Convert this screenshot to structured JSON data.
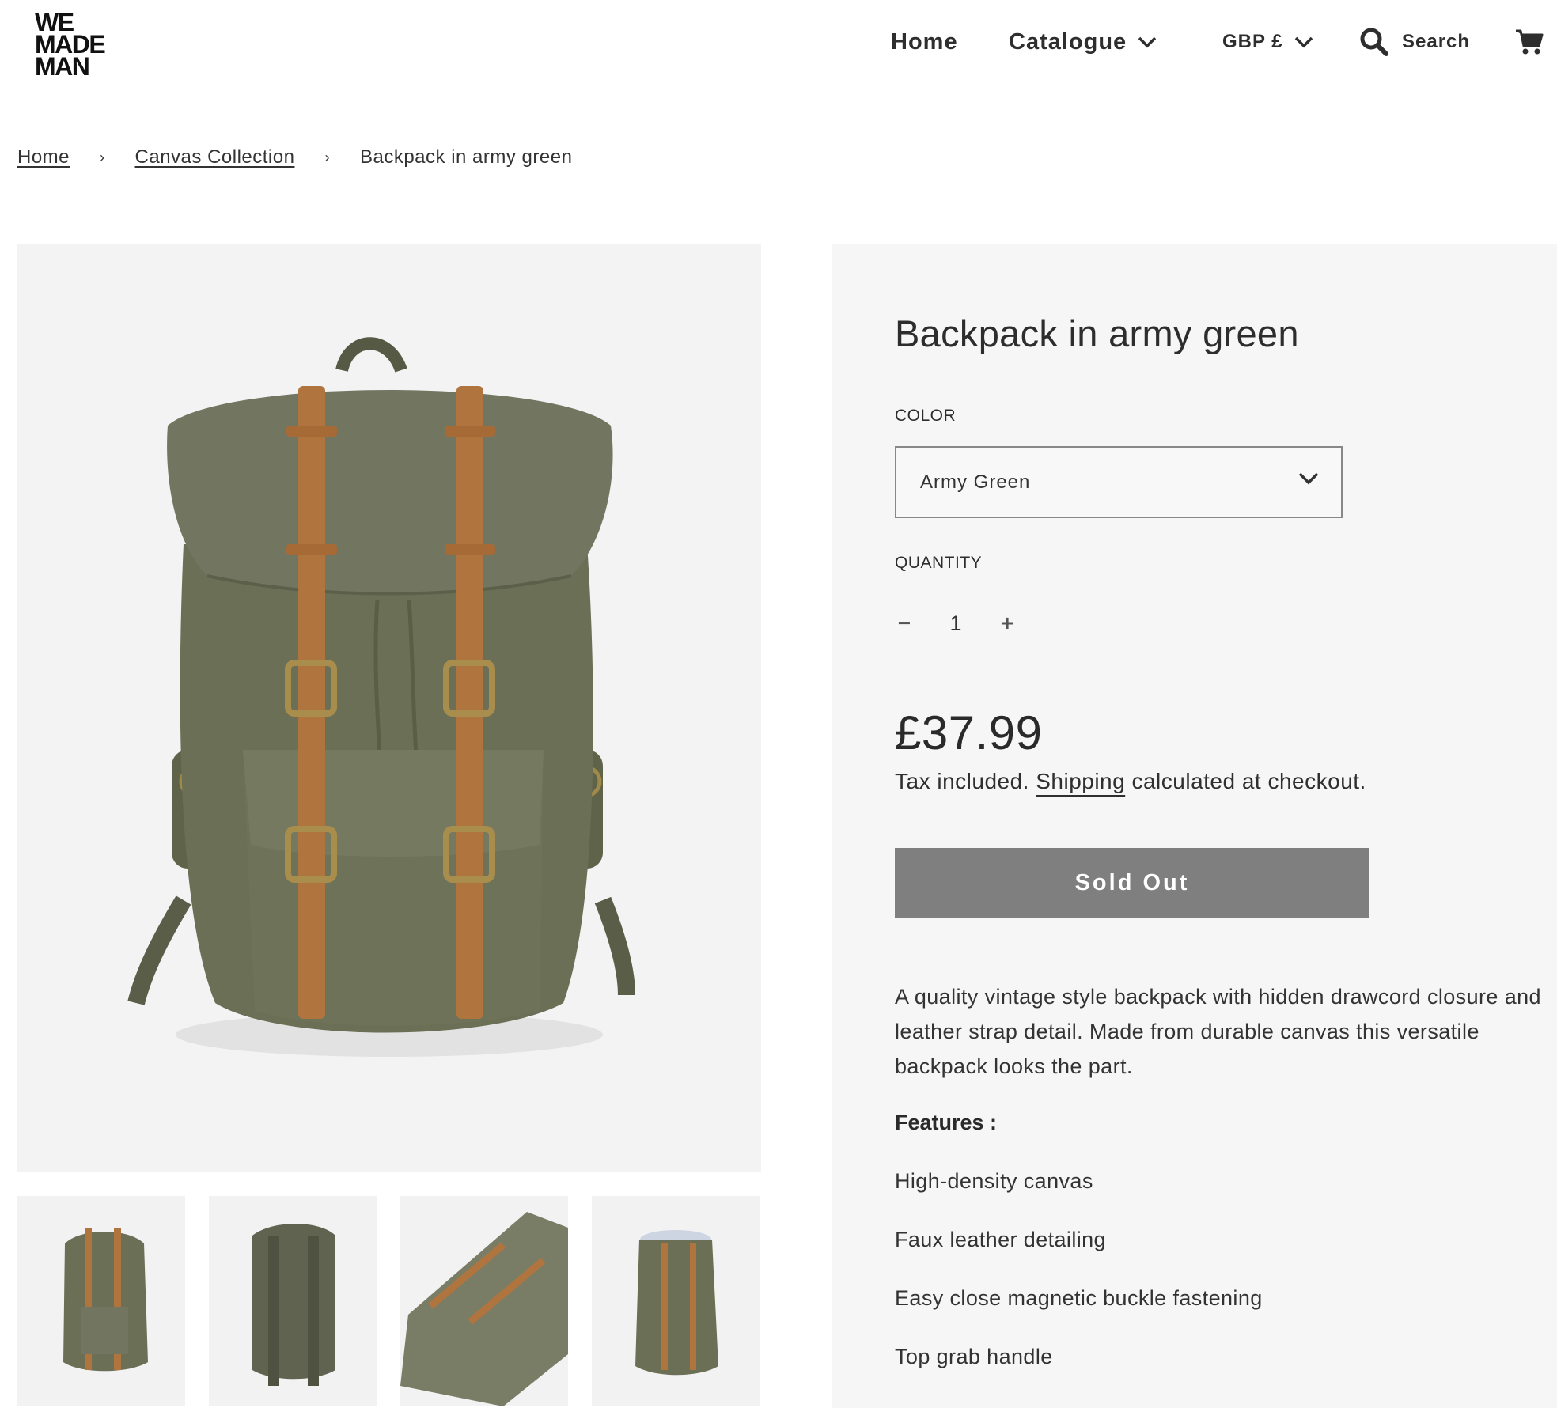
{
  "brand": {
    "logo_lines": [
      "WE",
      "MADE",
      "MAN"
    ]
  },
  "nav": {
    "home": "Home",
    "catalogue": "Catalogue",
    "currency": "GBP £",
    "search": "Search",
    "icons": [
      "chevron-down-icon",
      "search-icon",
      "cart-icon"
    ]
  },
  "breadcrumb": {
    "items": [
      "Home",
      "Canvas Collection",
      "Backpack in army green"
    ],
    "separator": "›"
  },
  "product": {
    "title": "Backpack in army green",
    "color_label": "COLOR",
    "color_value": "Army Green",
    "quantity_label": "QUANTITY",
    "quantity_value": "1",
    "minus": "−",
    "plus": "+",
    "price": "£37.99",
    "tax_prefix": "Tax included.",
    "tax_link": "Shipping",
    "tax_suffix": "calculated at checkout.",
    "button": "Sold Out",
    "description": "A quality vintage style backpack with hidden drawcord closure and leather strap detail. Made from durable canvas this versatile backpack looks the part.",
    "features_heading": "Features :",
    "features": [
      "High-density canvas",
      "Faux leather detailing",
      "Easy close magnetic buckle fastening",
      "Top grab handle"
    ]
  },
  "colors": {
    "canvas": "#6b6f55",
    "leather": "#b0743f",
    "button_bg": "#7f7f7f",
    "panel_bg": "#f6f6f6"
  }
}
